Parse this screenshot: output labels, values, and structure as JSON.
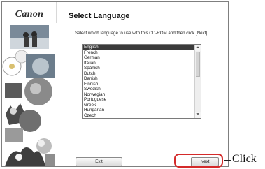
{
  "installer": {
    "logo": "Canon",
    "title": "Select Language",
    "instruction": "Select which language to use with this CD-ROM and then click [Next].",
    "languages": {
      "items": [
        "English",
        "French",
        "German",
        "Italian",
        "Spanish",
        "Dutch",
        "Danish",
        "Finnish",
        "Swedish",
        "Norwegian",
        "Portuguese",
        "Greek",
        "Hungarian",
        "Czech"
      ],
      "selected": "English"
    },
    "buttons": {
      "exit": "Exit",
      "next": "Next"
    }
  },
  "annotation": {
    "label": "Click",
    "color": "#d42a2a"
  }
}
